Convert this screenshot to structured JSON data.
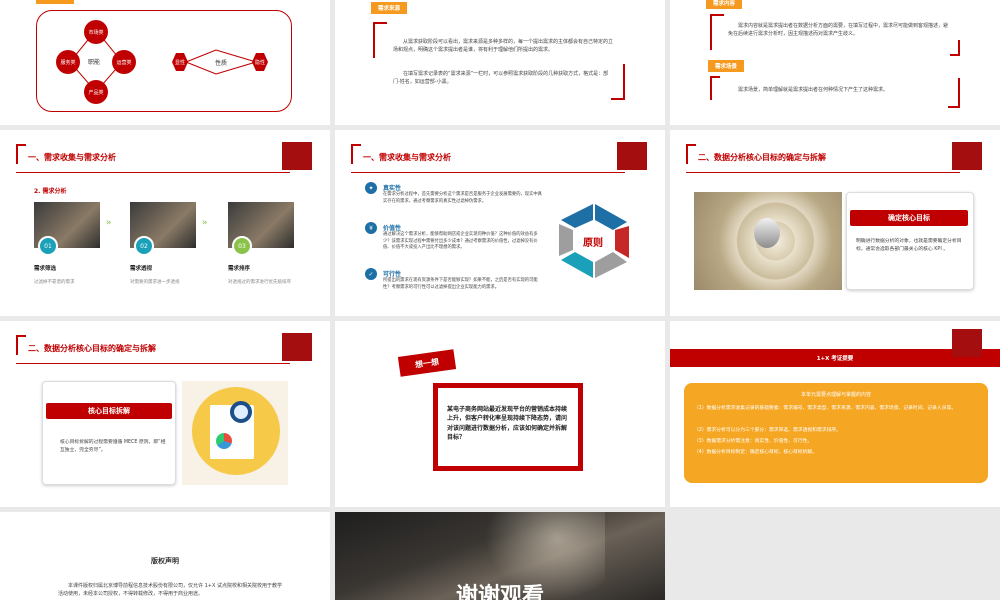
{
  "slide1": {
    "center": "职能",
    "top": "市场类",
    "left": "服务类",
    "right": "运营类",
    "bottom": "产品类",
    "hex_left": "显性",
    "hex_mid": "性质",
    "hex_right": "隐性"
  },
  "slide2": {
    "tag": "需求来源",
    "p1": "从需求获取阶段可以看出，需求来源是多种多样的，每一个提出需求的主体都会有自己特定的立场和观点，明确这个需求提出者是谁，将有利于理解他们所提出的需求。",
    "p2": "在填写需求记录表的“需求来源”一栏时，可以参照需求获取阶段的几种获取方式，格式是：部门-姓名，如运营部-小黑。"
  },
  "slide3": {
    "tag_top": "需求内容",
    "p1": "需求内容就是需求提出者在数据分析方面的需要，在填写过程中，需求尽可能做到客观描述，避免在后续进行需求分析时，因主观描述而对需求产生歧义。",
    "tag2": "需求场景",
    "p2": "需求场景，简单理解就是需求提出者在何种情况下产生了这种需求。"
  },
  "slide4": {
    "title": "一、需求收集与需求分析",
    "sub": "2. 需求分析",
    "items": [
      {
        "num": "01",
        "title": "需求筛选",
        "desc": "过滤掉不靠谱的需求"
      },
      {
        "num": "02",
        "title": "需求透视",
        "desc": "对需要的需求进一步透视"
      },
      {
        "num": "03",
        "title": "需求排序",
        "desc": "对透视过的需求进行优先级排序"
      }
    ]
  },
  "slide5": {
    "title": "一、需求收集与需求分析",
    "center": "原则",
    "items": [
      {
        "title": "真实性",
        "text": "在需求分析过程中，首先需要分析这个需求是否是服务于企业发展需要的，现实中真实存在的需求，通过考察需求的真实性过滤掉伪需求。"
      },
      {
        "title": "价值性",
        "text": "通过解决这个需求分析，能够帮助网店或企业实现何种价值？这种价值的效益有多少？该需求实现过程中需要付出多少成本？通过考察需求的价值性，过滤掉没有价值、价值不大或投入产出比不理想的需求。"
      },
      {
        "title": "可行性",
        "text": "所提出的需求在现有资源条件下是否能够实现？如果不能，之后是否有实现的可能性？考察需求的可行性可以过滤掉提出企业实现能力的需求。"
      }
    ]
  },
  "slide6": {
    "title": "二、数据分析核心目标的确定与拆解",
    "card_title": "确定核心目标",
    "card_text": "明确进行数据分析的对象，也就是需要确定分析目标，通常会选取各部门最关心的核心 KPI 。"
  },
  "slide7": {
    "title": "二、数据分析核心目标的确定与拆解",
    "card_title": "核心目标拆解",
    "card_text": "核心目标拆解的过程需要遵循 MECE 原则，即“相互独立，完全穷尽”。"
  },
  "slide8": {
    "badge": "想一想",
    "text": "某电子商务网站最近发现平台的营销成本持续上升，但客户转化率呈现持续下降态势，请问对该问题进行数据分析，应该如何确定并拆解目标？"
  },
  "slide9": {
    "header": "1+X 考证提要",
    "box_title": "本单元需要点理解与掌握的内容",
    "lines": [
      "（1）数据分析需求收集记录的基础要素：需求编号、需求类型、需求来源、需求内容、需求场景、记录时间、记录人员等。",
      "（2）需求分析可以分为三个部分：需求筛选、需求透视和需求排序。",
      "（3）数据需求分析需注意：真实性、价值性、可行性。",
      "（4）数据分析目标制定：确定核心目标、核心目标拆解。"
    ]
  },
  "slide10": {
    "title": "版权声明",
    "text": "本课件版权归属北京博导前程信息技术股份有限公司，仅允许 1+X 试点院校和相关院校用于教学活动使用，未经本公司授权，不得转载修改，不得用于商业用途。"
  },
  "slide11": {
    "text": "谢谢观看"
  },
  "colors": {
    "accent": "#c00000",
    "dark_red": "#a50e0e",
    "orange": "#f59a1e",
    "teal": "#1aa0b8",
    "green": "#8bc34a",
    "blue": "#1d6fa5"
  }
}
